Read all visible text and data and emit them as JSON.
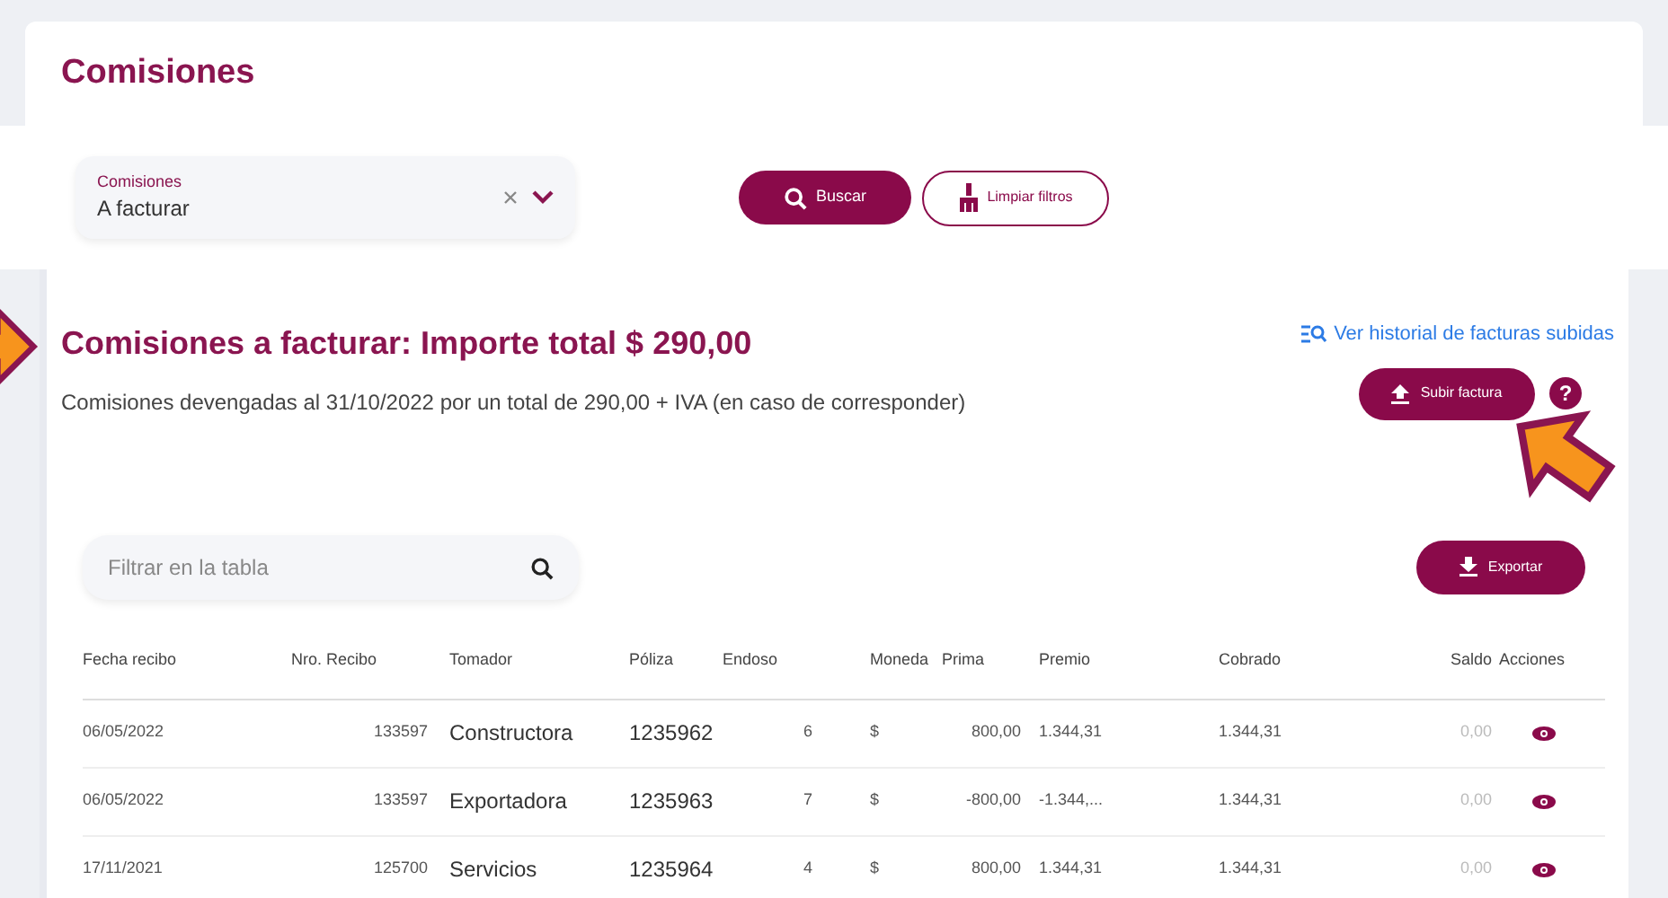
{
  "page_title": "Comisiones",
  "filter": {
    "label": "Comisiones",
    "value": "A facturar"
  },
  "buttons": {
    "search": "Buscar",
    "clear": "Limpiar filtros"
  },
  "summary": {
    "title": "Comisiones a facturar: Importe total $ 290,00",
    "subtitle": "Comisiones devengadas al 31/10/2022 por un total de 290,00 + IVA (en caso de corresponder)",
    "history_link": "Ver historial de facturas subidas",
    "upload": "Subir factura",
    "help": "?"
  },
  "table_filter": {
    "placeholder": "Filtrar en la tabla"
  },
  "export": "Exportar",
  "table": {
    "columns": [
      "Fecha recibo",
      "Nro. Recibo",
      "Tomador",
      "Póliza",
      "Endoso",
      "Moneda",
      "Prima",
      "Premio",
      "Cobrado",
      "Saldo",
      "Acciones"
    ],
    "rows": [
      {
        "cells": [
          "06/05/2022",
          "133597",
          "Constructora",
          "1235962",
          "6",
          "$",
          "800,00",
          "1.344,31",
          "1.344,31",
          "0,00"
        ]
      },
      {
        "cells": [
          "06/05/2022",
          "133597",
          "Exportadora",
          "1235963",
          "7",
          "$",
          "-800,00",
          "-1.344,...",
          "1.344,31",
          "0,00"
        ]
      },
      {
        "cells": [
          "17/11/2021",
          "125700",
          "Servicios",
          "1235964",
          "4",
          "$",
          "800,00",
          "1.344,31",
          "1.344,31",
          "0,00"
        ]
      }
    ]
  }
}
